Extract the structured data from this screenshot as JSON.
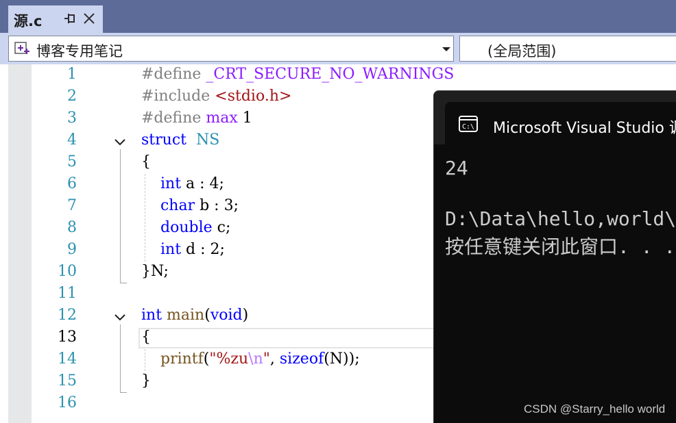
{
  "tab": {
    "name": "源.c",
    "pin_icon": "pin-icon",
    "close_icon": "close-icon"
  },
  "nav": {
    "left_label": "博客专用笔记",
    "left_icon": "project-icon",
    "right_label": "(全局范围)"
  },
  "editor": {
    "line_numbers": [
      "1",
      "2",
      "3",
      "4",
      "5",
      "6",
      "7",
      "8",
      "9",
      "10",
      "11",
      "12",
      "13",
      "14",
      "15",
      "16"
    ],
    "current_line": "13",
    "lines": {
      "l1": {
        "directive": "#define",
        "name": "_CRT_SECURE_NO_WARNINGS"
      },
      "l2": {
        "directive": "#include",
        "header": "<stdio.h>"
      },
      "l3": {
        "directive": "#define",
        "macro": "max",
        "value": "1"
      },
      "l4": {
        "keyword": "struct",
        "name": "NS"
      },
      "l5": {
        "text": "{"
      },
      "l6": {
        "type": "int",
        "rest": "a : 4;"
      },
      "l7": {
        "type": "char",
        "rest": "b : 3;"
      },
      "l8": {
        "type": "double",
        "rest": "c;"
      },
      "l9": {
        "type": "int",
        "rest": "d : 2;"
      },
      "l10": {
        "text": "}N;"
      },
      "l12": {
        "type": "int",
        "fn": "main",
        "open": "(",
        "param": "void",
        "close": ")"
      },
      "l13": {
        "text": "{"
      },
      "l14": {
        "fn": "printf",
        "open": "(",
        "str_a": "\"%zu",
        "esc": "\\n",
        "str_b": "\"",
        "comma": ", ",
        "op": "sizeof",
        "arg": "(N));"
      },
      "l15": {
        "text": "}"
      }
    }
  },
  "console": {
    "icon": "terminal-icon",
    "title": "Microsoft Visual Studio 调试控制台",
    "output": [
      "24",
      "D:\\Data\\hello,world\\",
      "按任意键关闭此窗口. . ."
    ]
  },
  "watermark": "CSDN @Starry_hello world"
}
